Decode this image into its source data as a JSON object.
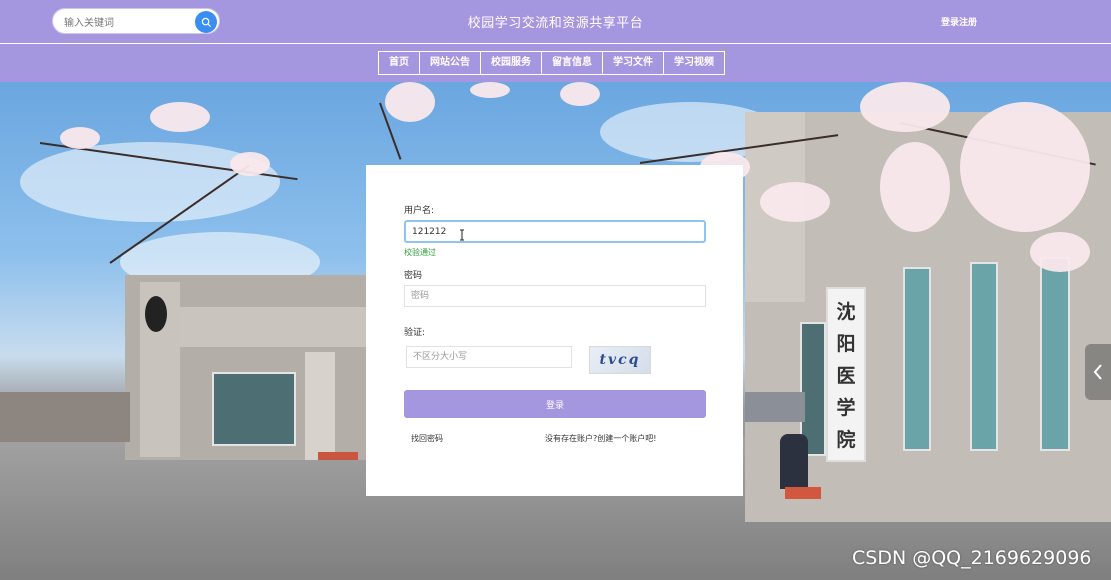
{
  "header": {
    "search_placeholder": "输入关键词",
    "site_title": "校园学习交流和资源共享平台",
    "login_register": "登录注册"
  },
  "nav": {
    "items": [
      "首页",
      "网站公告",
      "校园服务",
      "留言信息",
      "学习文件",
      "学习视频"
    ]
  },
  "login": {
    "username_label": "用户名:",
    "username_value": "121212",
    "username_status": "校验通过",
    "password_label": "密码",
    "password_placeholder": "密码",
    "captcha_label": "验证:",
    "captcha_placeholder": "不区分大小写",
    "captcha_code": "tvcq",
    "submit_label": "登录",
    "forgot_link": "找回密码",
    "register_link": "没有存在账户?创建一个账户吧!"
  },
  "background": {
    "sign_text": [
      "沈",
      "阳",
      "医",
      "学",
      "院"
    ]
  },
  "watermark": "CSDN @QQ_2169629096",
  "colors": {
    "theme": "#a596e0",
    "search_button": "#3b8ef0",
    "success": "#2e9c3a"
  },
  "icons": {
    "search": "search-icon",
    "side_arrow": "chevron-left-icon"
  }
}
